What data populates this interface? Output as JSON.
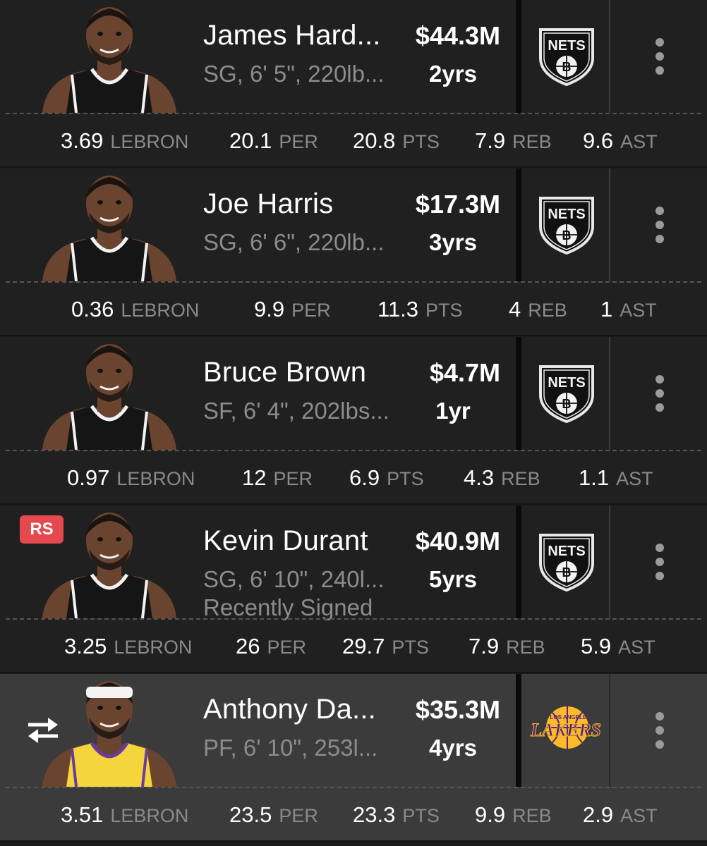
{
  "cards": [
    {
      "name": "James Hard...",
      "details": "SG, 6' 5\", 220lb...",
      "status": "",
      "salary": "$44.3M",
      "years": "2yrs",
      "team_logo": "nets-logo",
      "badge": "",
      "jersey": "nets",
      "selected": false,
      "stats": [
        {
          "value": "3.69",
          "label": "LEBRON"
        },
        {
          "value": "20.1",
          "label": "PER"
        },
        {
          "value": "20.8",
          "label": "PTS"
        },
        {
          "value": "7.9",
          "label": "REB"
        },
        {
          "value": "9.6",
          "label": "AST"
        }
      ]
    },
    {
      "name": "Joe Harris",
      "details": "SG, 6' 6\", 220lb...",
      "status": "",
      "salary": "$17.3M",
      "years": "3yrs",
      "team_logo": "nets-logo",
      "badge": "",
      "jersey": "nets",
      "selected": false,
      "stats": [
        {
          "value": "0.36",
          "label": "LEBRON"
        },
        {
          "value": "9.9",
          "label": "PER"
        },
        {
          "value": "11.3",
          "label": "PTS"
        },
        {
          "value": "4",
          "label": "REB"
        },
        {
          "value": "1",
          "label": "AST"
        }
      ]
    },
    {
      "name": "Bruce Brown",
      "details": "SF, 6' 4\", 202lbs...",
      "status": "",
      "salary": "$4.7M",
      "years": "1yr",
      "team_logo": "nets-logo",
      "badge": "",
      "jersey": "nets",
      "selected": false,
      "stats": [
        {
          "value": "0.97",
          "label": "LEBRON"
        },
        {
          "value": "12",
          "label": "PER"
        },
        {
          "value": "6.9",
          "label": "PTS"
        },
        {
          "value": "4.3",
          "label": "REB"
        },
        {
          "value": "1.1",
          "label": "AST"
        }
      ]
    },
    {
      "name": "Kevin Durant",
      "details": "SG, 6' 10\", 240l...",
      "status": "Recently Signed",
      "salary": "$40.9M",
      "years": "5yrs",
      "team_logo": "nets-logo",
      "badge": "RS",
      "jersey": "nets",
      "selected": false,
      "stats": [
        {
          "value": "3.25",
          "label": "LEBRON"
        },
        {
          "value": "26",
          "label": "PER"
        },
        {
          "value": "29.7",
          "label": "PTS"
        },
        {
          "value": "7.9",
          "label": "REB"
        },
        {
          "value": "5.9",
          "label": "AST"
        }
      ]
    },
    {
      "name": "Anthony Da...",
      "details": "PF, 6' 10\", 253l...",
      "status": "",
      "salary": "$35.3M",
      "years": "4yrs",
      "team_logo": "lakers-logo",
      "badge": "",
      "jersey": "lakers",
      "selected": true,
      "stats": [
        {
          "value": "3.51",
          "label": "LEBRON"
        },
        {
          "value": "23.5",
          "label": "PER"
        },
        {
          "value": "23.3",
          "label": "PTS"
        },
        {
          "value": "9.9",
          "label": "REB"
        },
        {
          "value": "2.9",
          "label": "AST"
        }
      ]
    }
  ],
  "logo_text": {
    "nets": "NETS",
    "nets_ball": "B",
    "lakers_top": "LOS ANGELES",
    "lakers_main": "LAKERS"
  },
  "colors": {
    "card_bg": "#202020",
    "card_selected_bg": "#3b3b3b",
    "text_primary": "#ffffff",
    "text_secondary": "#8c8c8c",
    "badge_red": "#e5484d",
    "lakers_purple": "#552583",
    "lakers_gold": "#fdb927"
  },
  "icons": {
    "menu": "vertical-dots-icon",
    "swap": "swap-arrows-icon"
  }
}
